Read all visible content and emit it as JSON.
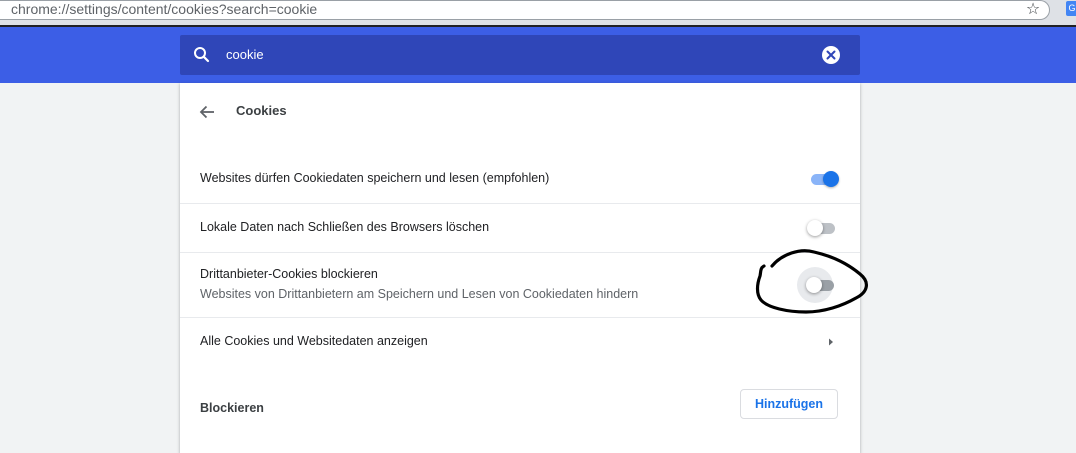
{
  "browser": {
    "url": "chrome://settings/content/cookies?search=cookie",
    "star_icon": "star-icon",
    "extension_icon_letter": "G"
  },
  "search": {
    "query": "cookie",
    "icon": "search-icon",
    "clear_icon": "clear-icon"
  },
  "subpage": {
    "title": "Cookies",
    "back_icon": "arrow-back-icon"
  },
  "settings": {
    "allow_cookies": {
      "label": "Websites dürfen Cookiedaten speichern und lesen (empfohlen)",
      "enabled": true
    },
    "clear_on_exit": {
      "label": "Lokale Daten nach Schließen des Browsers löschen",
      "enabled": false
    },
    "block_third_party": {
      "label": "Drittanbieter-Cookies blockieren",
      "sublabel": "Websites von Drittanbietern am Speichern und Lesen von Cookiedaten hindern",
      "enabled": false
    },
    "all_cookies": {
      "label": "Alle Cookies und Websitedaten anzeigen",
      "icon": "arrow-right-icon"
    },
    "block_section": {
      "label": "Blockieren",
      "add_button": "Hinzufügen"
    }
  },
  "colors": {
    "toolbar": "#3c5ee6",
    "searchbox": "#2f46b8",
    "toggle_on": "#1a73e8",
    "toggle_on_bar": "#8ab4f8",
    "toggle_off_bar": "#bdc1c6",
    "button_text": "#1a73e8"
  }
}
